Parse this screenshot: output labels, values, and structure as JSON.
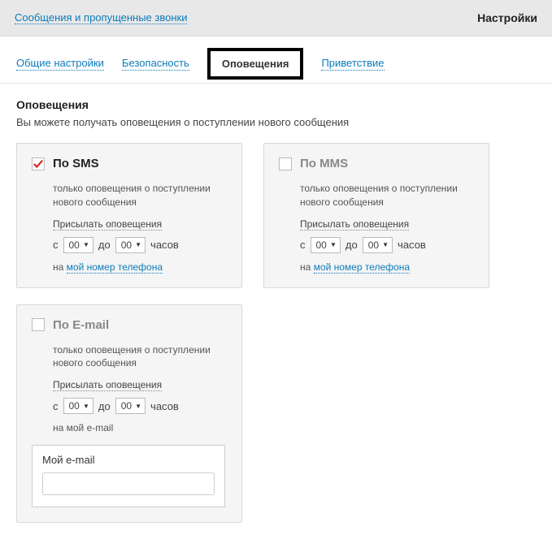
{
  "header": {
    "breadcrumb": "Сообщения и пропущенные звонки",
    "title": "Настройки"
  },
  "tabs": {
    "general": "Общие настройки",
    "security": "Безопасность",
    "notifications": "Оповещения",
    "greeting": "Приветствие"
  },
  "section": {
    "title": "Оповещения",
    "description": "Вы можете получать оповещения о поступлении нового сообщения"
  },
  "cards": {
    "sms": {
      "title": "По SMS",
      "info": "только оповещения о поступлении нового сообщения",
      "send_label": "Присылать оповещения",
      "from_label": "с",
      "to_label": "до",
      "hours_label": "часов",
      "from_value": "00",
      "to_value": "00",
      "dest_prefix": "на ",
      "dest_link": "мой номер телефона"
    },
    "mms": {
      "title": "По MMS",
      "info": "только оповещения о поступлении нового сообщения",
      "send_label": "Присылать оповещения",
      "from_label": "с",
      "to_label": "до",
      "hours_label": "часов",
      "from_value": "00",
      "to_value": "00",
      "dest_prefix": "на ",
      "dest_link": "мой номер телефона"
    },
    "email": {
      "title": "По E-mail",
      "info": "только оповещения о поступлении нового сообщения",
      "send_label": "Присылать оповещения",
      "from_label": "с",
      "to_label": "до",
      "hours_label": "часов",
      "from_value": "00",
      "to_value": "00",
      "dest_text": "на мой e-mail",
      "input_label": "Мой e-mail",
      "input_value": ""
    }
  }
}
